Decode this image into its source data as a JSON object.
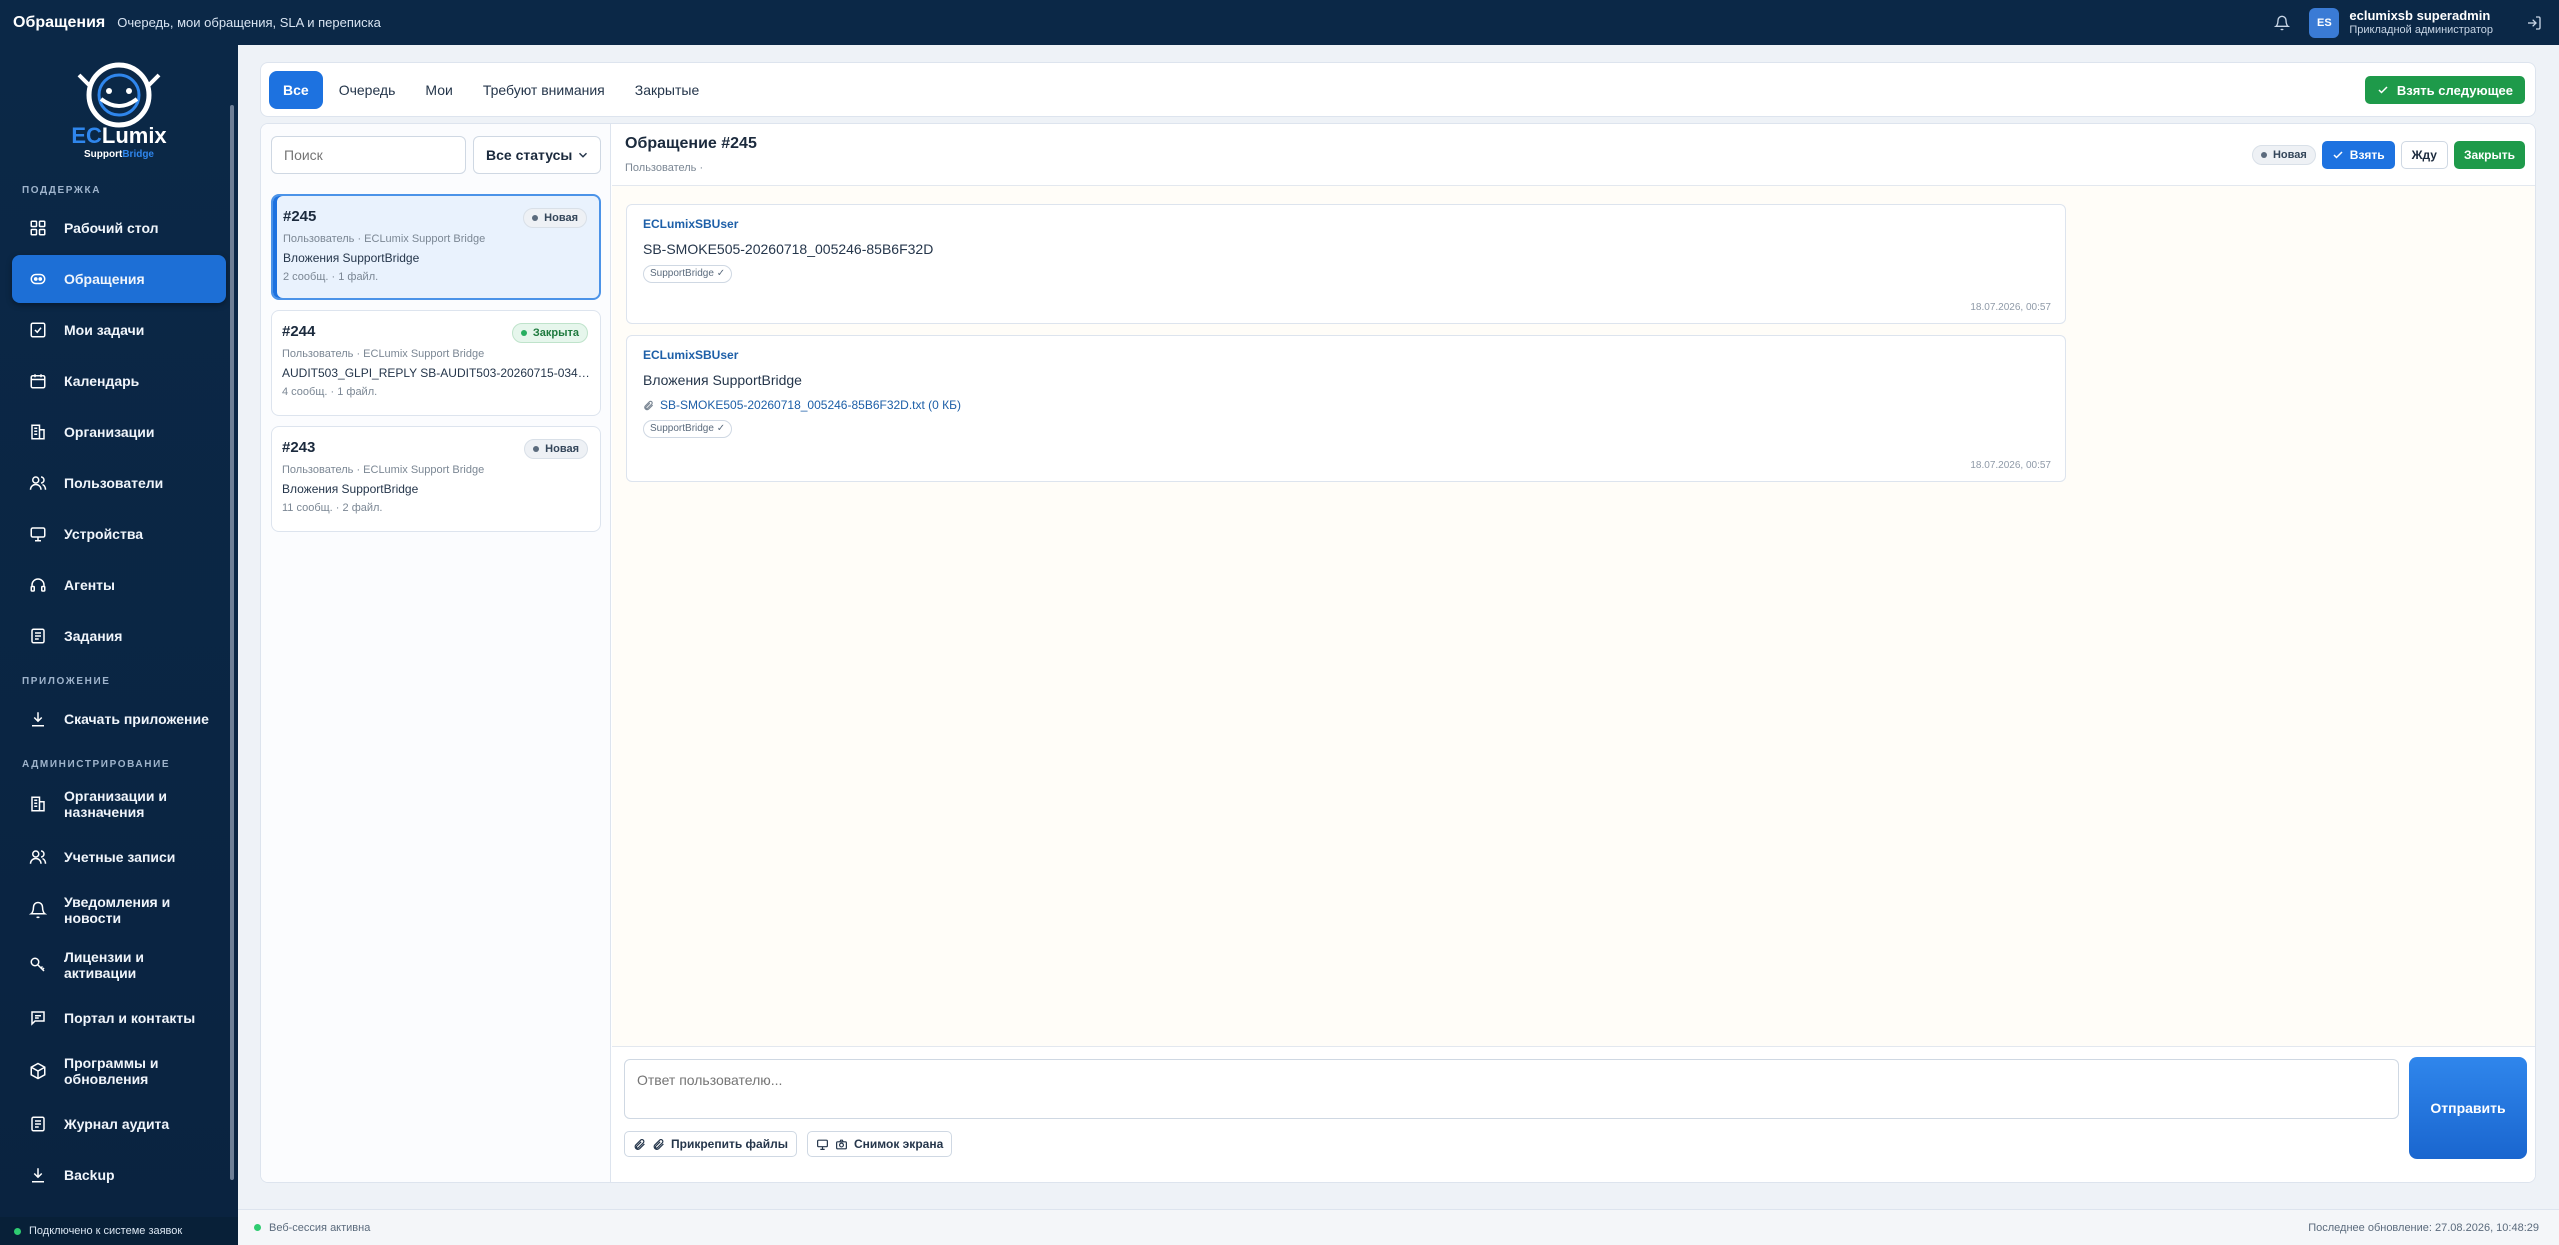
{
  "topbar": {
    "title": "Обращения",
    "subtitle": "Очередь, мои обращения, SLA и переписка",
    "avatar": "ES",
    "user_name": "eclumixsb superadmin",
    "user_role": "Прикладной администратор"
  },
  "logo": {
    "name_ec": "EC",
    "name_lumix": "Lumix",
    "tag_support": "Support",
    "tag_bridge": "Bridge"
  },
  "sidebar": {
    "section_support": "ПОДДЕРЖКА",
    "support_items": [
      {
        "label": "Рабочий стол",
        "icon": "dashboard-icon"
      },
      {
        "label": "Обращения",
        "icon": "chat-icon"
      },
      {
        "label": "Мои задачи",
        "icon": "checkbox-icon"
      },
      {
        "label": "Календарь",
        "icon": "calendar-icon"
      },
      {
        "label": "Организации",
        "icon": "building-icon"
      },
      {
        "label": "Пользователи",
        "icon": "users-icon"
      },
      {
        "label": "Устройства",
        "icon": "monitor-icon"
      },
      {
        "label": "Агенты",
        "icon": "headset-icon"
      },
      {
        "label": "Задания",
        "icon": "list-icon"
      }
    ],
    "section_app": "ПРИЛОЖЕНИЕ",
    "app_items": [
      {
        "label": "Скачать приложение",
        "icon": "download-icon"
      }
    ],
    "section_admin": "АДМИНИСТРИРОВАНИЕ",
    "admin_items": [
      {
        "label": "Организации и назначения",
        "icon": "building-icon"
      },
      {
        "label": "Учетные записи",
        "icon": "users-icon"
      },
      {
        "label": "Уведомления и новости",
        "icon": "bell-icon"
      },
      {
        "label": "Лицензии и активации",
        "icon": "key-icon"
      },
      {
        "label": "Портал и контакты",
        "icon": "message-icon"
      },
      {
        "label": "Программы и обновления",
        "icon": "package-icon"
      },
      {
        "label": "Журнал аудита",
        "icon": "journal-icon"
      },
      {
        "label": "Backup",
        "icon": "download-icon"
      }
    ],
    "footer": "Подключено к системе заявок"
  },
  "tabs": [
    "Все",
    "Очередь",
    "Мои",
    "Требуют внимания",
    "Закрытые"
  ],
  "take_next": "Взять следующее",
  "search": {
    "placeholder": "Поиск"
  },
  "status_filter": "Все статусы",
  "tickets": [
    {
      "num": "#245",
      "badge": "Новая",
      "meta": "Пользователь · ECLumix Support Bridge",
      "subject": "Вложения SupportBridge",
      "count": "2 сообщ. · 1 файл."
    },
    {
      "num": "#244",
      "badge": "Закрыта",
      "meta": "Пользователь · ECLumix Support Bridge",
      "subject": "AUDIT503_GLPI_REPLY SB-AUDIT503-20260715-034715-8929…",
      "count": "4 сообщ. · 1 файл."
    },
    {
      "num": "#243",
      "badge": "Новая",
      "meta": "Пользователь · ECLumix Support Bridge",
      "subject": "Вложения SupportBridge",
      "count": "11 сообщ. · 2 файл."
    }
  ],
  "detail": {
    "title": "Обращение #245",
    "sub": "Пользователь ·",
    "status": "Новая",
    "take": "Взять",
    "wait": "Жду",
    "close": "Закрыть"
  },
  "messages": [
    {
      "author": "ECLumixSBUser",
      "text": "SB-SMOKE505-20260718_005246-85B6F32D",
      "chip": "SupportBridge ✓",
      "time": "18.07.2026, 00:57"
    },
    {
      "author": "ECLumixSBUser",
      "text": "Вложения SupportBridge",
      "file": "SB-SMOKE505-20260718_005246-85B6F32D.txt (0 КБ)",
      "chip": "SupportBridge ✓",
      "time": "18.07.2026, 00:57"
    }
  ],
  "composer": {
    "placeholder": "Ответ пользователю...",
    "attach": "Прикрепить файлы",
    "screenshot": "Снимок экрана",
    "send": "Отправить"
  },
  "status_footer": {
    "session": "Веб-сессия активна",
    "updated": "Последнее обновление: 27.08.2026, 10:48:29"
  }
}
